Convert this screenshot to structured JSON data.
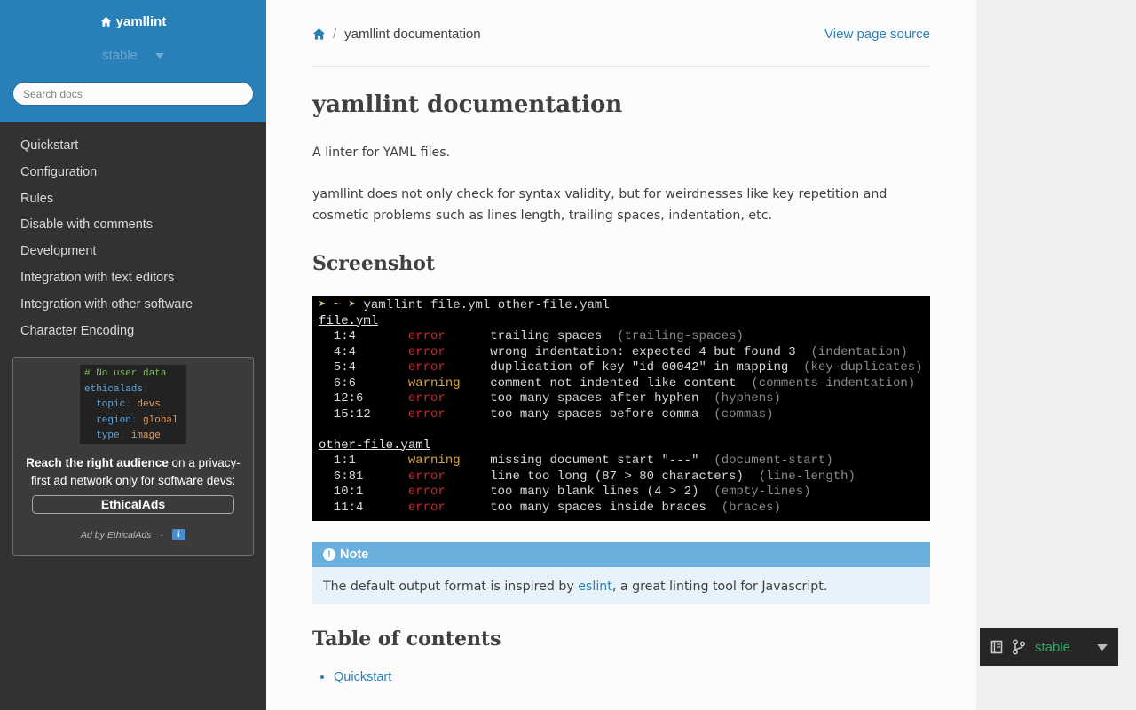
{
  "sidebar": {
    "project": "yamllint",
    "version": "stable",
    "search_placeholder": "Search docs",
    "nav": [
      "Quickstart",
      "Configuration",
      "Rules",
      "Disable with comments",
      "Development",
      "Integration with text editors",
      "Integration with other software",
      "Character Encoding"
    ]
  },
  "ad": {
    "code": {
      "comment": "# No user data",
      "root": "ethicalads",
      "items": [
        {
          "key": "topic",
          "value": "devs"
        },
        {
          "key": "region",
          "value": "global"
        },
        {
          "key": "type",
          "value": "image"
        }
      ]
    },
    "text_bold": "Reach the right audience",
    "text_rest": " on a privacy-first ad network only for software devs:",
    "button": "EthicalAds",
    "footer": "Ad by EthicalAds",
    "footer_sep": "·",
    "info": "i"
  },
  "breadcrumb": {
    "current": "yamllint documentation",
    "sep": "/",
    "source_link": "View page source"
  },
  "page": {
    "title": "yamllint documentation",
    "intro": "A linter for YAML files.",
    "description": "yamllint does not only check for syntax validity, but for weirdnesses like key repetition and cosmetic problems such as lines length, trailing spaces, indentation, etc.",
    "screenshot_heading": "Screenshot",
    "toc_heading": "Table of contents",
    "toc": [
      "Quickstart"
    ]
  },
  "terminal": {
    "prompt": "➤ ~ ➤",
    "command": " yamllint file.yml other-file.yaml",
    "files": [
      {
        "name": "file.yml",
        "lines": [
          {
            "pos": "1:4",
            "level": "error",
            "msg": "trailing spaces",
            "rule": "(trailing-spaces)"
          },
          {
            "pos": "4:4",
            "level": "error",
            "msg": "wrong indentation: expected 4 but found 3",
            "rule": "(indentation)"
          },
          {
            "pos": "5:4",
            "level": "error",
            "msg": "duplication of key \"id-00042\" in mapping",
            "rule": "(key-duplicates)"
          },
          {
            "pos": "6:6",
            "level": "warning",
            "msg": "comment not indented like content",
            "rule": "(comments-indentation)"
          },
          {
            "pos": "12:6",
            "level": "error",
            "msg": "too many spaces after hyphen",
            "rule": "(hyphens)"
          },
          {
            "pos": "15:12",
            "level": "error",
            "msg": "too many spaces before comma",
            "rule": "(commas)"
          }
        ]
      },
      {
        "name": "other-file.yaml",
        "lines": [
          {
            "pos": "1:1",
            "level": "warning",
            "msg": "missing document start \"---\"",
            "rule": "(document-start)"
          },
          {
            "pos": "6:81",
            "level": "error",
            "msg": "line too long (87 > 80 characters)",
            "rule": "(line-length)"
          },
          {
            "pos": "10:1",
            "level": "error",
            "msg": "too many blank lines (4 > 2)",
            "rule": "(empty-lines)"
          },
          {
            "pos": "11:4",
            "level": "error",
            "msg": "too many spaces inside braces",
            "rule": "(braces)"
          }
        ]
      }
    ]
  },
  "note": {
    "title": "Note",
    "icon": "!",
    "before": "The default output format is inspired by ",
    "link": "eslint",
    "after": ", a great linting tool for Javascript."
  },
  "flyout": {
    "version": "stable"
  },
  "colors": {
    "sidebar_top": "#2980b9",
    "sidebar_bg": "#343131",
    "link": "#2980b9",
    "note_title": "#6ab0de",
    "note_bg": "#e7f2fa",
    "flyout_text": "#27ae60"
  }
}
